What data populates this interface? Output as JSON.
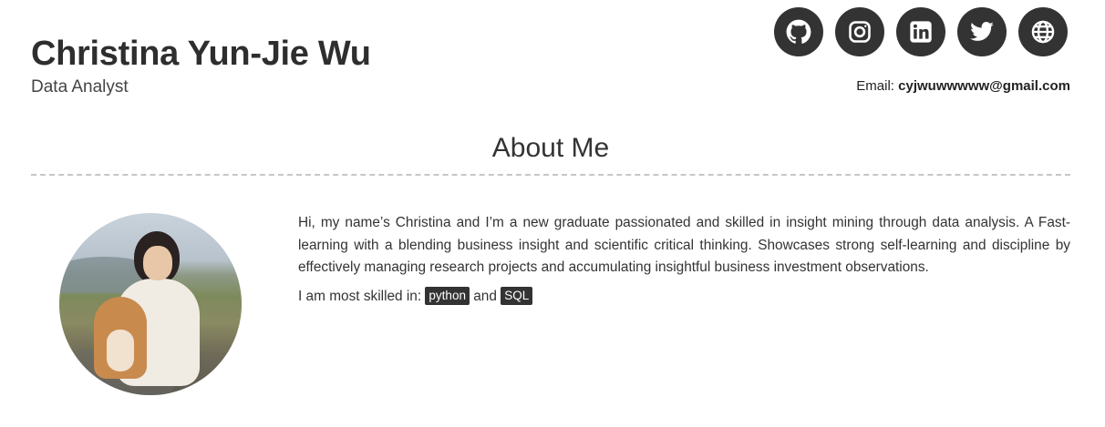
{
  "header": {
    "name": "Christina Yun-Jie Wu",
    "role": "Data Analyst"
  },
  "socials": [
    {
      "icon": "github-icon"
    },
    {
      "icon": "instagram-icon"
    },
    {
      "icon": "linkedin-icon"
    },
    {
      "icon": "twitter-icon"
    },
    {
      "icon": "globe-icon"
    }
  ],
  "contact": {
    "email_label": "Email:",
    "email": "cyjwuwwwww@gmail.com"
  },
  "about": {
    "title": "About Me",
    "bio": "Hi, my name’s Christina and I’m a new graduate passionated and skilled in insight mining through data analysis. A Fast-learning with a blending business insight and scientific critical thinking. Showcases strong self-learning and discipline by effectively managing research projects and accumulating insightful business investment observations.",
    "skills_prefix": "I am most skilled in:",
    "skills_joiner": "and",
    "skills": [
      "python",
      "SQL"
    ]
  },
  "colors": {
    "icon_bg": "#333333",
    "text": "#2e2e2e",
    "divider": "#c6c6c6"
  }
}
